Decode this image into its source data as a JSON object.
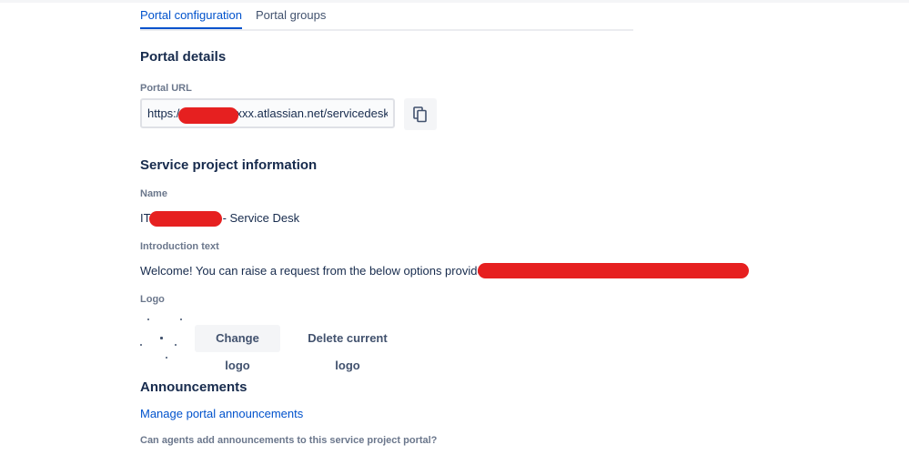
{
  "tabs": [
    {
      "label": "Portal configuration",
      "active": true
    },
    {
      "label": "Portal groups",
      "active": false
    }
  ],
  "portal_details": {
    "heading": "Portal details",
    "url_label": "Portal URL",
    "url_value": "https://xxxxxxxxxxxx.atlassian.net/servicedesk/customer/portals",
    "copy_icon": "copy-icon"
  },
  "service_project": {
    "heading": "Service project information",
    "name_label": "Name",
    "name_prefix": "IT",
    "name_suffix": "- Service Desk",
    "intro_label": "Introduction text",
    "intro_value": "Welcome! You can raise a request from the below options provided"
  },
  "logo": {
    "label": "Logo",
    "change_button": "Change logo",
    "delete_button": "Delete current logo"
  },
  "announcements": {
    "heading": "Announcements",
    "manage_link": "Manage portal announcements",
    "agents_label": "Can agents add announcements to this service project portal?"
  },
  "colors": {
    "link": "#0052cc",
    "text": "#172b4d",
    "label": "#6b778c",
    "redaction": "#e62020"
  }
}
